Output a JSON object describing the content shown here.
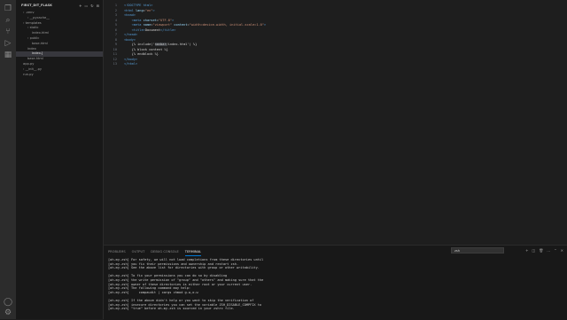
{
  "explorer": {
    "project_title": "FIRST_DIT_FLASK",
    "tree": [
      {
        "label": "› .venv",
        "indent": 1
      },
      {
        "label": "› __pycache__",
        "indent": 2
      },
      {
        "label": "› templates",
        "indent": 1
      },
      {
        "label": "› static",
        "indent": 2
      },
      {
        "label": "  index.html",
        "indent": 3
      },
      {
        "label": "› public",
        "indent": 2
      },
      {
        "label": "  base.html",
        "indent": 3
      },
      {
        "label": "  index",
        "indent": 2
      },
      {
        "label": "  index.[",
        "indent": 3
      },
      {
        "label": "  base.html",
        "indent": 2
      },
      {
        "label": "  app.py",
        "indent": 1
      },
      {
        "label": "› __init__.py",
        "indent": 1
      },
      {
        "label": "  run.py",
        "indent": 1
      }
    ]
  },
  "editor": {
    "lines": [
      {
        "n": "1",
        "parts": [
          {
            "c": "tok-dt",
            "t": "<!DOCTYPE html>"
          }
        ]
      },
      {
        "n": "2",
        "parts": [
          {
            "c": "tok-tag",
            "t": "<html "
          },
          {
            "c": "tok-attr",
            "t": "lang"
          },
          {
            "c": "tok-text",
            "t": "="
          },
          {
            "c": "tok-str",
            "t": "\"en\""
          },
          {
            "c": "tok-tag",
            "t": ">"
          }
        ]
      },
      {
        "n": "3",
        "parts": [
          {
            "c": "tok-tag",
            "t": "<head>"
          }
        ]
      },
      {
        "n": "4",
        "parts": [
          {
            "c": "tok-text",
            "t": "    "
          },
          {
            "c": "tok-tag",
            "t": "<meta "
          },
          {
            "c": "tok-attr",
            "t": "charset"
          },
          {
            "c": "tok-text",
            "t": "="
          },
          {
            "c": "tok-str",
            "t": "\"UTF-8\""
          },
          {
            "c": "tok-tag",
            "t": ">"
          }
        ]
      },
      {
        "n": "5",
        "parts": [
          {
            "c": "tok-text",
            "t": "    "
          },
          {
            "c": "tok-tag",
            "t": "<meta "
          },
          {
            "c": "tok-attr",
            "t": "name"
          },
          {
            "c": "tok-text",
            "t": "="
          },
          {
            "c": "tok-str",
            "t": "\"viewport\""
          },
          {
            "c": "tok-text",
            "t": " "
          },
          {
            "c": "tok-attr",
            "t": "content"
          },
          {
            "c": "tok-text",
            "t": "="
          },
          {
            "c": "tok-str",
            "t": "\"width=device-width, initial-scale=1.0\""
          },
          {
            "c": "tok-tag",
            "t": ">"
          }
        ]
      },
      {
        "n": "6",
        "parts": [
          {
            "c": "tok-text",
            "t": "    "
          },
          {
            "c": "tok-tag",
            "t": "<title>"
          },
          {
            "c": "tok-text",
            "t": "Document"
          },
          {
            "c": "tok-tag",
            "t": "</title>"
          }
        ]
      },
      {
        "n": "7",
        "parts": [
          {
            "c": "tok-tag",
            "t": "</head>"
          }
        ]
      },
      {
        "n": "8",
        "parts": [
          {
            "c": "tok-tag",
            "t": "<body>"
          }
        ]
      },
      {
        "n": "9",
        "parts": [
          {
            "c": "tok-text",
            "t": "    {% include('"
          },
          {
            "c": "tok-hl",
            "t": "navbar"
          },
          {
            "c": "tok-text",
            "t": "/index.html') %}"
          }
        ]
      },
      {
        "n": "10",
        "parts": [
          {
            "c": "tok-text",
            "t": "    {% block content %}"
          }
        ]
      },
      {
        "n": "11",
        "parts": [
          {
            "c": "tok-text",
            "t": "    {% endblock %}"
          }
        ]
      },
      {
        "n": "12",
        "parts": [
          {
            "c": "tok-tag",
            "t": "</body>"
          }
        ]
      },
      {
        "n": "13",
        "parts": [
          {
            "c": "tok-tag",
            "t": "</html>"
          }
        ]
      }
    ]
  },
  "panel": {
    "tabs": [
      "PROBLEMS",
      "OUTPUT",
      "DEBUG CONSOLE",
      "TERMINAL"
    ],
    "active_tab": 3,
    "terminal_select": "zsh",
    "terminal_lines": [
      "[oh-my-zsh] For safety, we will not load completions from these directories until",
      "[oh-my-zsh] you fix their permissions and ownership and restart zsh.",
      "[oh-my-zsh] See the above list for directories with group or other writability.",
      "",
      "[oh-my-zsh] To fix your permissions you can do so by disabling",
      "[oh-my-zsh] the write permission of \"group\" and \"others\" and making sure that the",
      "[oh-my-zsh] owner of these directories is either root or your current user.",
      "[oh-my-zsh] The following command may help:",
      "[oh-my-zsh]     compaudit | xargs chmod g-w,o-w",
      "",
      "[oh-my-zsh] If the above didn't help or you want to skip the verification of",
      "[oh-my-zsh] insecure directories you can set the variable ZSH_DISABLE_COMPFIX to",
      "[oh-my-zsh] \"true\" before oh-my-zsh is sourced in your zshrc file."
    ]
  }
}
